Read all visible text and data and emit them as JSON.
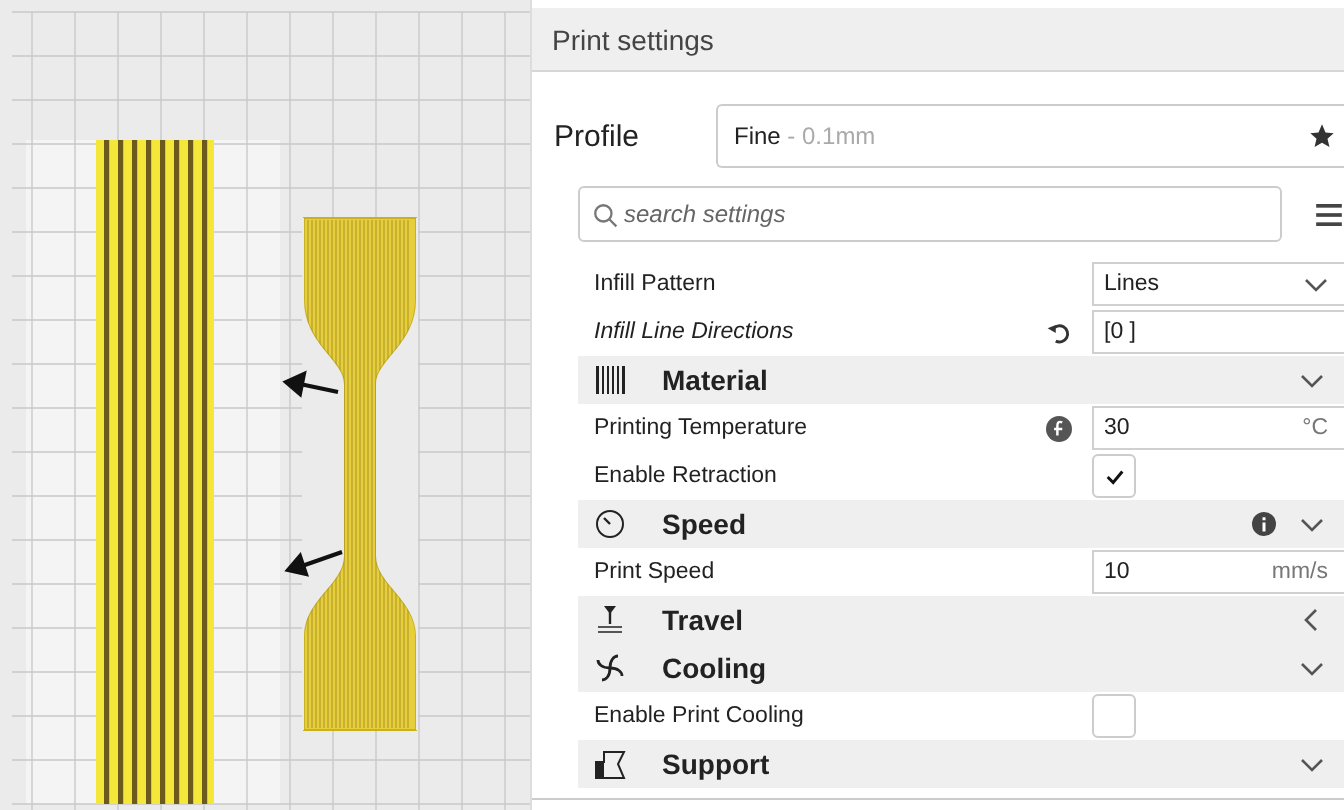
{
  "panel": {
    "title": "Print settings"
  },
  "profile": {
    "label": "Profile",
    "name": "Fine",
    "detail": " - 0.1mm"
  },
  "search": {
    "placeholder": "search settings"
  },
  "settings": [
    {
      "kind": "dropdown",
      "label": "Infill Pattern",
      "value": "Lines"
    },
    {
      "kind": "text",
      "label": "Infill Line Directions",
      "value": "[0 ]",
      "modified": true
    },
    {
      "kind": "category",
      "label": "Material",
      "expanded": true
    },
    {
      "kind": "text",
      "label": "Printing Temperature",
      "value": "30",
      "unit": "°C",
      "formula": true
    },
    {
      "kind": "checkbox",
      "label": "Enable Retraction",
      "checked": true
    },
    {
      "kind": "category",
      "label": "Speed",
      "expanded": true,
      "info": true
    },
    {
      "kind": "text",
      "label": "Print Speed",
      "value": "10",
      "unit": "mm/s"
    },
    {
      "kind": "category",
      "label": "Travel",
      "expanded": false
    },
    {
      "kind": "category",
      "label": "Cooling",
      "expanded": true
    },
    {
      "kind": "checkbox",
      "label": "Enable Print Cooling",
      "checked": false
    },
    {
      "kind": "category",
      "label": "Support",
      "expanded": true
    }
  ]
}
